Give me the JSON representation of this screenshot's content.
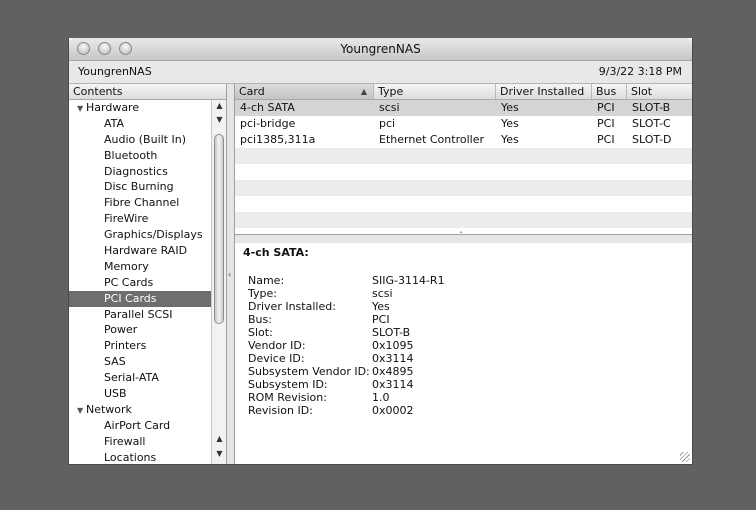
{
  "window": {
    "title": "YoungrenNAS"
  },
  "infobar": {
    "computer_name": "YoungrenNAS",
    "datetime": "9/3/22 3:18 PM"
  },
  "sidebar": {
    "header": "Contents",
    "rows": [
      {
        "label": "Hardware",
        "type": "category"
      },
      {
        "label": "ATA",
        "type": "item"
      },
      {
        "label": "Audio (Built In)",
        "type": "item"
      },
      {
        "label": "Bluetooth",
        "type": "item"
      },
      {
        "label": "Diagnostics",
        "type": "item"
      },
      {
        "label": "Disc Burning",
        "type": "item"
      },
      {
        "label": "Fibre Channel",
        "type": "item"
      },
      {
        "label": "FireWire",
        "type": "item"
      },
      {
        "label": "Graphics/Displays",
        "type": "item"
      },
      {
        "label": "Hardware RAID",
        "type": "item"
      },
      {
        "label": "Memory",
        "type": "item"
      },
      {
        "label": "PC Cards",
        "type": "item"
      },
      {
        "label": "PCI Cards",
        "type": "item",
        "selected": true
      },
      {
        "label": "Parallel SCSI",
        "type": "item"
      },
      {
        "label": "Power",
        "type": "item"
      },
      {
        "label": "Printers",
        "type": "item"
      },
      {
        "label": "SAS",
        "type": "item"
      },
      {
        "label": "Serial-ATA",
        "type": "item"
      },
      {
        "label": "USB",
        "type": "item"
      },
      {
        "label": "Network",
        "type": "category"
      },
      {
        "label": "AirPort Card",
        "type": "item"
      },
      {
        "label": "Firewall",
        "type": "item"
      },
      {
        "label": "Locations",
        "type": "item"
      }
    ]
  },
  "table": {
    "columns": [
      "Card",
      "Type",
      "Driver Installed",
      "Bus",
      "Slot"
    ],
    "rows": [
      [
        "4-ch SATA",
        "scsi",
        "Yes",
        "PCI",
        "SLOT-B"
      ],
      [
        "pci-bridge",
        "pci",
        "Yes",
        "PCI",
        "SLOT-C"
      ],
      [
        "pci1385,311a",
        "Ethernet Controller",
        "Yes",
        "PCI",
        "SLOT-D"
      ]
    ]
  },
  "detail": {
    "title": "4-ch SATA:",
    "fields": [
      {
        "key": "Name:",
        "value": "SIIG-3114-R1"
      },
      {
        "key": "Type:",
        "value": "scsi"
      },
      {
        "key": "Driver Installed:",
        "value": "Yes"
      },
      {
        "key": "Bus:",
        "value": "PCI"
      },
      {
        "key": "Slot:",
        "value": "SLOT-B"
      },
      {
        "key": "Vendor ID:",
        "value": "0x1095"
      },
      {
        "key": "Device ID:",
        "value": "0x3114"
      },
      {
        "key": "Subsystem Vendor ID:",
        "value": "0x4895"
      },
      {
        "key": "Subsystem ID:",
        "value": "0x3114"
      },
      {
        "key": "ROM Revision:",
        "value": "1.0"
      },
      {
        "key": "Revision ID:",
        "value": "0x0002"
      }
    ]
  }
}
